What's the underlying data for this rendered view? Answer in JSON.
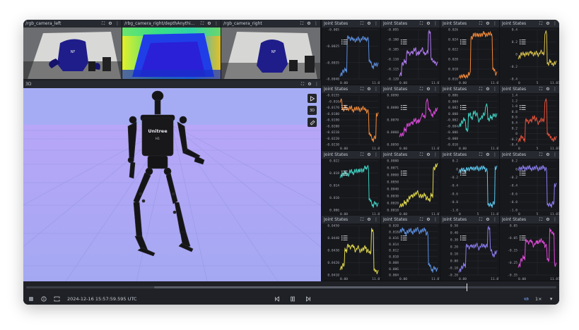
{
  "cameras": [
    {
      "title": "/rgb_camera_left"
    },
    {
      "title": "/rbg_camera_right/depthAnythi..."
    },
    {
      "title": "/rgb_camera_right"
    }
  ],
  "view3d": {
    "title": "3D",
    "mode_label": "3D"
  },
  "robot": {
    "brand": "Unitree",
    "model": "H1"
  },
  "chart_title": "Joint States",
  "timeline": {
    "timestamp": "2024-12-16 15:57:59.595 UTC",
    "speed": "1×"
  },
  "colors": {
    "accent": "#6d9cf0",
    "panel": "#17181c"
  },
  "chart_data": [
    {
      "type": "line",
      "title": "Joint States",
      "yticks": [
        "-0.005",
        "-0.0025",
        "-0.0035",
        "-0.0040"
      ],
      "xticks": [
        "0.00",
        "11.07"
      ],
      "color": "#5b8fe0",
      "values": [
        0.1,
        0.15,
        0.18,
        0.85,
        0.8,
        0.82,
        0.78,
        0.81,
        0.79,
        0.83,
        0.8,
        0.82,
        0.35,
        0.25,
        0.3,
        0.28
      ]
    },
    {
      "type": "line",
      "title": "Joint States",
      "yticks": [
        "-0.095",
        "-0.100",
        "-0.105",
        "-0.110",
        "-0.115",
        "-0.120"
      ],
      "xticks": [
        "0.00",
        "11.07"
      ],
      "color": "#b07cf0",
      "values": [
        0.1,
        0.3,
        0.35,
        0.55,
        0.5,
        0.55,
        0.6,
        0.5,
        0.55,
        0.6,
        0.5,
        0.55,
        0.95,
        0.4,
        0.35,
        0.3
      ]
    },
    {
      "type": "line",
      "title": "Joint States",
      "yticks": [
        "0.026",
        "0.024",
        "0.022",
        "0.020",
        "0.018",
        "0.016"
      ],
      "xticks": [
        "0.00",
        "11.07"
      ],
      "color": "#f0883a",
      "values": [
        0.05,
        0.05,
        0.05,
        0.06,
        0.1,
        0.85,
        0.9,
        0.88,
        0.9,
        0.89,
        0.92,
        0.9,
        0.91,
        0.9,
        0.2,
        0.1
      ]
    },
    {
      "type": "line",
      "title": "Joint States",
      "yticks": [
        "0.4",
        "0.2",
        "0",
        "-0.2",
        "-0.4"
      ],
      "xticks": [
        "0",
        "5",
        "11.07"
      ],
      "color": "#d8c04a",
      "values": [
        0.45,
        0.5,
        0.5,
        0.52,
        0.5,
        0.55,
        0.5,
        0.52,
        0.5,
        0.55,
        0.5,
        0.95,
        0.3,
        0.35,
        0.3,
        0.32
      ]
    },
    {
      "type": "line",
      "title": "Joint States",
      "yticks": [
        "-0.0155",
        "-0.016",
        "-0.0170",
        "-0.0180",
        "-0.0190",
        "-0.0200",
        "-0.0210",
        "-0.0220",
        "-0.0230"
      ],
      "xticks": [
        "0.00",
        "11.07"
      ],
      "color": "#f08a3a",
      "values": [
        0.9,
        0.7,
        0.75,
        0.72,
        0.74,
        0.7,
        0.73,
        0.72,
        0.71,
        0.74,
        0.7,
        0.68,
        0.2,
        0.1,
        0.15,
        0.6
      ]
    },
    {
      "type": "line",
      "title": "Joint States",
      "yticks": [
        "0.0090",
        "0.0080",
        "0.0070",
        "0.0060",
        "0.0050"
      ],
      "xticks": [
        "0.00",
        "11.07"
      ],
      "color": "#d84ad8",
      "values": [
        0.2,
        0.2,
        0.3,
        0.4,
        0.4,
        0.45,
        0.5,
        0.45,
        0.5,
        0.6,
        0.55,
        0.9,
        0.7,
        0.6,
        0.65,
        0.7
      ]
    },
    {
      "type": "line",
      "title": "Joint States",
      "yticks": [
        "0.006",
        "0.004",
        "0.002",
        "0.000",
        "-0.002",
        "-0.004",
        "-0.006",
        "-0.008",
        "-0.010"
      ],
      "xticks": [
        "0.00",
        "11.07"
      ],
      "color": "#3fd0c0",
      "values": [
        0.4,
        0.45,
        0.5,
        0.3,
        0.6,
        0.55,
        0.65,
        0.6,
        0.5,
        0.55,
        0.6,
        0.8,
        0.5,
        0.55,
        0.6,
        0.58
      ]
    },
    {
      "type": "line",
      "title": "Joint States",
      "yticks": [
        "1.4",
        "1.2",
        "1.0",
        "0.8",
        "0.6",
        "0.4",
        "0.2",
        "0",
        "-0.2",
        "-0.4"
      ],
      "xticks": [
        "0",
        "5",
        "11.07"
      ],
      "color": "#e0503a",
      "values": [
        0.1,
        0.15,
        0.1,
        0.5,
        0.45,
        0.5,
        0.55,
        0.5,
        0.45,
        0.5,
        0.48,
        0.9,
        0.2,
        0.15,
        0.1,
        0.12
      ]
    },
    {
      "type": "line",
      "title": "Joint States",
      "yticks": [
        "0.022",
        "0.018",
        "0.014",
        "0.010",
        "0.006"
      ],
      "xticks": [
        "0.00",
        "11.07"
      ],
      "color": "#3fd0c0",
      "values": [
        0.7,
        0.72,
        0.75,
        0.72,
        0.78,
        0.76,
        0.8,
        0.78,
        0.82,
        0.8,
        0.85,
        0.88,
        0.2,
        0.1,
        0.15,
        0.1
      ]
    },
    {
      "type": "line",
      "title": "Joint States",
      "yticks": [
        "0.0080",
        "0.0071",
        "0.0060",
        "0.0050",
        "0.0040",
        "0.0030",
        "0.0020",
        "0.0010"
      ],
      "xticks": [
        "0.00",
        "11.07"
      ],
      "color": "#e0d84a",
      "values": [
        0.1,
        0.1,
        0.15,
        0.2,
        0.25,
        0.3,
        0.32,
        0.35,
        0.3,
        0.28,
        0.3,
        0.25,
        0.2,
        0.3,
        0.85,
        0.9
      ]
    },
    {
      "type": "line",
      "title": "Joint States",
      "yticks": [
        "0.2",
        "0",
        "-0.2",
        "-0.4",
        "-0.6",
        "-0.8",
        "-1.0"
      ],
      "xticks": [
        "0",
        "5",
        "11.07"
      ],
      "color": "#5bc8f0",
      "values": [
        0.8,
        0.82,
        0.8,
        0.84,
        0.82,
        0.86,
        0.84,
        0.85,
        0.84,
        0.86,
        0.85,
        0.82,
        0.1,
        0.1,
        0.15,
        0.85
      ]
    },
    {
      "type": "line",
      "title": "Joint States",
      "yticks": [
        "0.2",
        "0",
        "-0.2",
        "-0.4",
        "-0.6",
        "-0.8",
        "-1.0"
      ],
      "xticks": [
        "0",
        "5",
        "11.07"
      ],
      "color": "#8a7cf0",
      "values": [
        0.85,
        0.84,
        0.86,
        0.85,
        0.86,
        0.84,
        0.85,
        0.86,
        0.84,
        0.85,
        0.86,
        0.84,
        0.1,
        0.1,
        0.15,
        0.5
      ]
    },
    {
      "type": "line",
      "title": "Joint States",
      "yticks": [
        "0.0450",
        "0.0440",
        "0.0430",
        "0.0420",
        "0.0410"
      ],
      "xticks": [
        "0.00",
        "11.07"
      ],
      "color": "#e0d84a",
      "values": [
        0.15,
        0.2,
        0.5,
        0.6,
        0.55,
        0.6,
        0.5,
        0.55,
        0.5,
        0.52,
        0.55,
        0.5,
        0.45,
        0.9,
        0.1,
        0.05
      ]
    },
    {
      "type": "line",
      "title": "Joint States",
      "yticks": [
        "0.020",
        "0.018",
        "0.016",
        "0.014",
        "0.012",
        "0.010",
        "0.008",
        "0.006",
        "0.004"
      ],
      "xticks": [
        "0.00",
        "11.07"
      ],
      "color": "#5b8fe0",
      "values": [
        0.9,
        0.92,
        0.85,
        0.88,
        0.9,
        0.87,
        0.9,
        0.92,
        0.88,
        0.9,
        0.91,
        0.85,
        0.2,
        0.1,
        0.15,
        0.1
      ]
    },
    {
      "type": "line",
      "title": "Joint States",
      "yticks": [
        "0.50",
        "0.40",
        "0.30",
        "0.20",
        "0.10",
        "0.00",
        "-0.10",
        "-0.20"
      ],
      "xticks": [
        "0.00",
        "11.07"
      ],
      "color": "#8a7cf0",
      "values": [
        0.1,
        0.15,
        0.2,
        0.6,
        0.55,
        0.6,
        0.58,
        0.6,
        0.55,
        0.6,
        0.58,
        0.6,
        0.95,
        0.5,
        0.4,
        0.45
      ]
    },
    {
      "type": "line",
      "title": "Joint States",
      "yticks": [
        "0.05",
        "-0.05",
        "-0.15",
        "-0.25",
        "-0.35"
      ],
      "xticks": [
        "0.00",
        "11.07"
      ],
      "color": "#e04ad8",
      "values": [
        0.2,
        0.3,
        0.35,
        0.7,
        0.65,
        0.7,
        0.6,
        0.65,
        0.68,
        0.7,
        0.65,
        0.6,
        0.3,
        0.9,
        0.85,
        0.2
      ]
    }
  ]
}
